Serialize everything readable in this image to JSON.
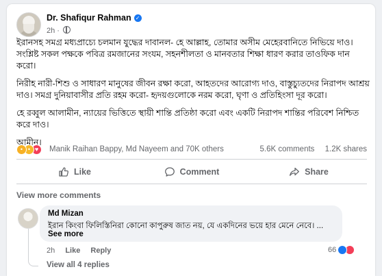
{
  "post": {
    "author": "Dr. Shafiqur Rahman",
    "time": "2h",
    "audience_icon": "globe-icon",
    "paragraphs": [
      "ইরানসহ সমগ্র মধ্যপ্রাচ্যে চলমান যুদ্ধের দাবানল- হে আল্লাহ, তোমার অসীম মেহেরবানিতে নিভিয়ে দাও। সংশ্লিষ্ট সকল পক্ষকে পবিত্র রমজানের সংযম, সহনশীলতা ও মানবতার শিক্ষা ধারণ করার তাওফিক দান করো।",
      "নিরীহ নারী-শিশু ও সাধারণ মানুষের জীবন রক্ষা করো, আহতদের আরোগ্য দাও, বাস্তুচ্যুতদের নিরাপদ আশ্রয় দাও। সমগ্র দুনিয়াবাসীর প্রতি রহম করো- হৃদয়গুলোকে নরম করো, ঘৃণা ও প্রতিহিংসা দূর করো।",
      "হে রব্বুল আলামীন, ন্যায়ের ভিত্তিতে স্থায়ী শান্তি প্রতিষ্ঠা করো এবং একটি নিরাপদ শান্তির পরিবেশ নিশ্চিত করে দাও।",
      "আমীন।"
    ]
  },
  "stats": {
    "reactors": "Manik Raihan Bappy, Md Nayeem and 70K others",
    "comments": "5.6K comments",
    "shares": "1.2K shares"
  },
  "actions": {
    "like": "Like",
    "comment": "Comment",
    "share": "Share"
  },
  "view_more_comments": "View more comments",
  "comment": {
    "author": "Md Mizan",
    "text": "ইরান কিংবা ফিলিস্তিনিরা কোনো কাপুরুষ জাত নয়, যে একদিনের ভয়ে হার মেনে নেবে। ...",
    "see_more": "See more",
    "time": "2h",
    "like": "Like",
    "reply": "Reply",
    "reaction_count": "66",
    "view_replies": "View all 4 replies"
  },
  "colors": {
    "accent": "#1877f2",
    "love": "#f33e58",
    "secondary_text": "#65676b"
  }
}
